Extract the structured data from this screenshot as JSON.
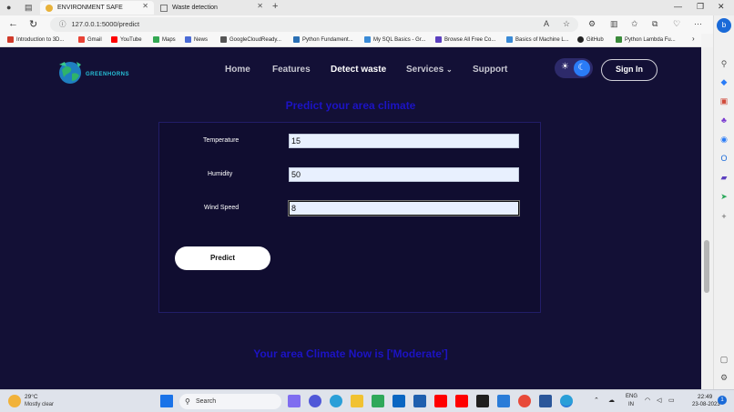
{
  "browser": {
    "tabs": [
      {
        "title": "ENVIRONMENT SAFE",
        "active": true
      },
      {
        "title": "Waste detection",
        "active": false
      }
    ],
    "url": "127.0.0.1:5000/predict",
    "bookmarks": [
      {
        "label": "Introduction to 3D...",
        "color": "#d03a2a"
      },
      {
        "label": "Gmail",
        "color": "#e94235"
      },
      {
        "label": "YouTube",
        "color": "#ff0000"
      },
      {
        "label": "Maps",
        "color": "#34a853"
      },
      {
        "label": "News",
        "color": "#4a6bd6"
      },
      {
        "label": "GoogleCloudReady...",
        "color": "#555555"
      },
      {
        "label": "Python Fundament...",
        "color": "#2a6fb4"
      },
      {
        "label": "My SQL Basics - Gr...",
        "color": "#3a8ad6"
      },
      {
        "label": "Browse All Free Co...",
        "color": "#5b3fbf"
      },
      {
        "label": "Basics of Machine L...",
        "color": "#3a8ad6"
      },
      {
        "label": "GitHub",
        "color": "#222222"
      },
      {
        "label": "Python Lambda Fu...",
        "color": "#3a8a3a"
      }
    ]
  },
  "site": {
    "logo_text": "GREENHORNS",
    "nav": [
      "Home",
      "Features",
      "Detect waste",
      "Services",
      "Support"
    ],
    "sign_in": "Sign In",
    "heading": "Predict your area climate",
    "form": {
      "temperature_label": "Temperature",
      "temperature_value": "15",
      "humidity_label": "Humidity",
      "humidity_value": "50",
      "wind_label": "Wind Speed",
      "wind_value": "8",
      "predict_label": "Predict"
    },
    "result": "Your area Climate Now is ['Moderate']"
  },
  "taskbar": {
    "weather_temp": "29°C",
    "weather_desc": "Mostly clear",
    "search_placeholder": "Search",
    "lang_line1": "ENG",
    "lang_line2": "IN",
    "time": "22:49",
    "date": "23-08-2023"
  },
  "colors": {
    "page_bg": "#131036",
    "accent_heading": "#1c13c4",
    "toggle_bg": "#2d2a6a",
    "toggle_knob": "#2a7cf7"
  }
}
